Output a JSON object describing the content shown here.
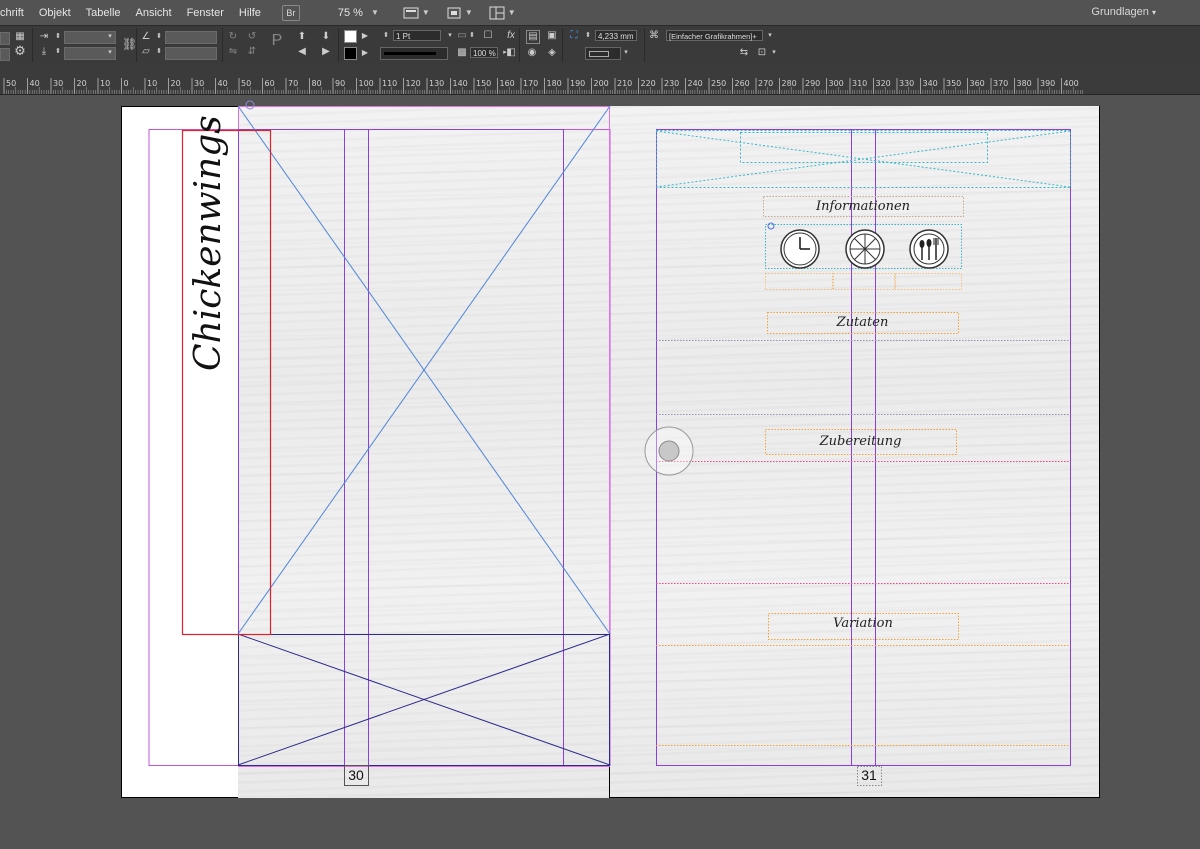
{
  "menu": {
    "items": [
      "chrift",
      "Objekt",
      "Tabelle",
      "Ansicht",
      "Fenster",
      "Hilfe"
    ],
    "bridge_label": "Br",
    "zoom": "75 %",
    "workspace": "Grundlagen"
  },
  "controls": {
    "stroke_weight": "1 Pt",
    "dimension": "4,233 mm",
    "opacity": "100 %",
    "object_style": "[Einfacher Grafikrahmen]+"
  },
  "ruler": {
    "labels": [
      "50",
      "40",
      "30",
      "20",
      "10",
      "0",
      "10",
      "20",
      "30",
      "40",
      "50",
      "60",
      "70",
      "80",
      "90",
      "100",
      "110",
      "120",
      "130",
      "140",
      "150",
      "160",
      "170",
      "180",
      "190",
      "200",
      "210",
      "220",
      "230",
      "240",
      "250",
      "260",
      "270",
      "280",
      "290",
      "300",
      "310",
      "320",
      "330",
      "340",
      "350",
      "360",
      "370",
      "380",
      "390",
      "400"
    ]
  },
  "left_page": {
    "title": "Chickenwings",
    "page_number": "30"
  },
  "right_page": {
    "page_number": "31",
    "sections": {
      "informationen": "Informationen",
      "zutaten": "Zutaten",
      "zubereitung": "Zubereitung",
      "variation": "Variation"
    },
    "icons": [
      "clock-icon",
      "pizza-slice-icon",
      "cutlery-icon"
    ]
  },
  "colors": {
    "margin_guide": "#c455e0",
    "column_guide": "#8a3fe0",
    "frame_blue": "#4f86d6",
    "frame_navy": "#2c2a8a",
    "frame_red": "#e0202a",
    "frame_teal": "#38b6c8",
    "frame_orange": "#f2a23a",
    "frame_pink": "#e24a8a",
    "pasteboard": "#535353"
  }
}
